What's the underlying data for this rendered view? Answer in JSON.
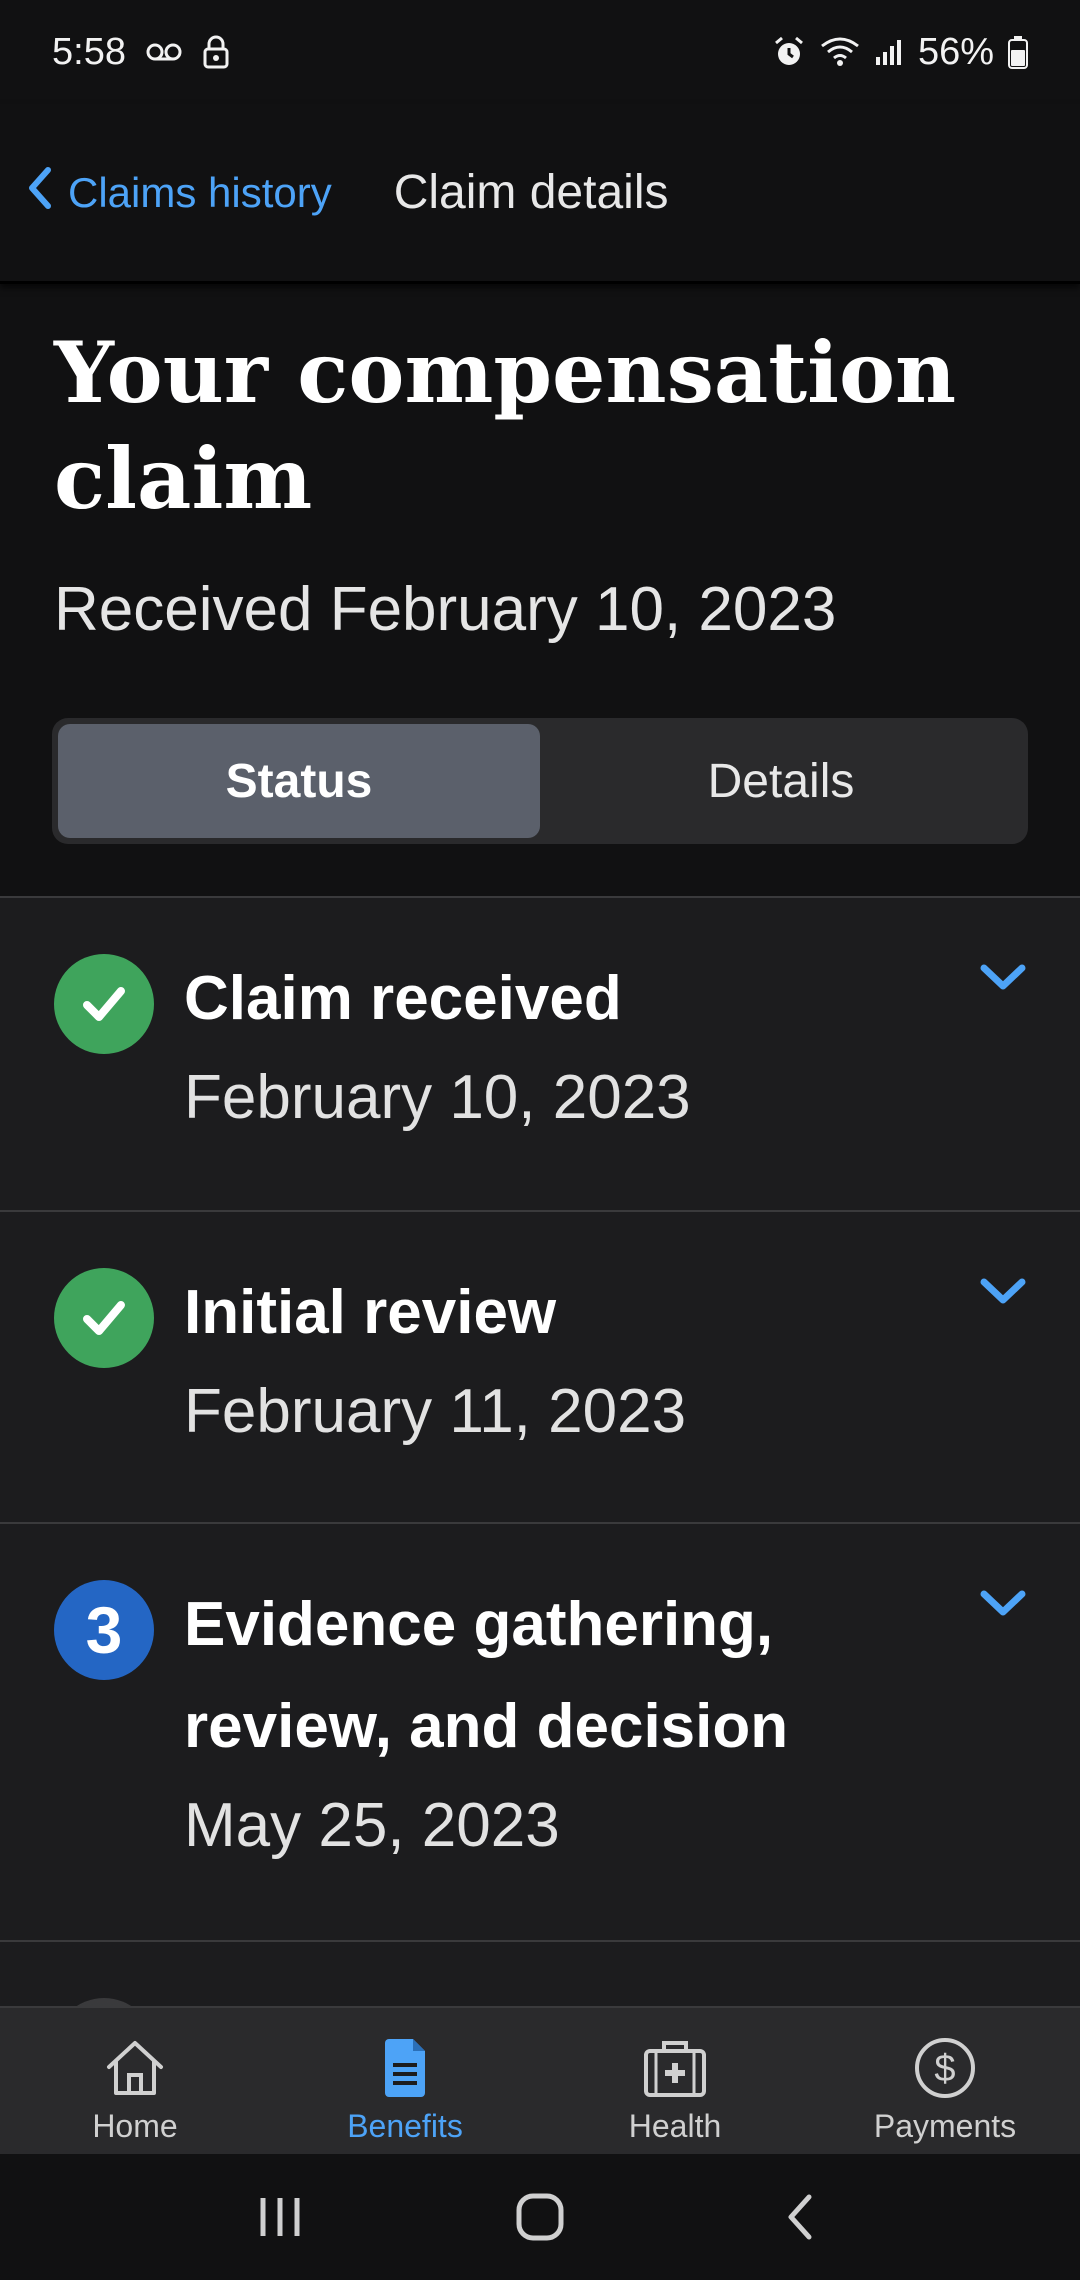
{
  "status_bar": {
    "time": "5:58",
    "battery": "56%",
    "icons": [
      "voicemail-icon",
      "lock-icon",
      "alarm-icon",
      "wifi-icon",
      "signal-icon",
      "battery-icon"
    ]
  },
  "nav": {
    "back_label": "Claims history",
    "title": "Claim details"
  },
  "page": {
    "title": "Your compensation claim",
    "received": "Received February 10, 2023"
  },
  "segments": {
    "selected": "Status",
    "items": [
      {
        "label": "Status"
      },
      {
        "label": "Details"
      }
    ]
  },
  "steps": [
    {
      "state": "complete",
      "icon": "check-icon",
      "title": "Claim received",
      "date": "February 10, 2023"
    },
    {
      "state": "complete",
      "icon": "check-icon",
      "title": "Initial review",
      "date": "February 11, 2023"
    },
    {
      "state": "current",
      "number": "3",
      "title": "Evidence gathering, review, and decision",
      "date": "May 25, 2023"
    }
  ],
  "tab_bar": {
    "selected": "Benefits",
    "tabs": [
      {
        "label": "Home",
        "icon": "home-icon"
      },
      {
        "label": "Benefits",
        "icon": "document-icon"
      },
      {
        "label": "Health",
        "icon": "medical-kit-icon"
      },
      {
        "label": "Payments",
        "icon": "dollar-circle-icon"
      }
    ]
  },
  "colors": {
    "accent": "#4da3f7",
    "complete": "#3fa45c",
    "current": "#2466c4",
    "background": "#111112",
    "card": "#1c1c1e"
  }
}
